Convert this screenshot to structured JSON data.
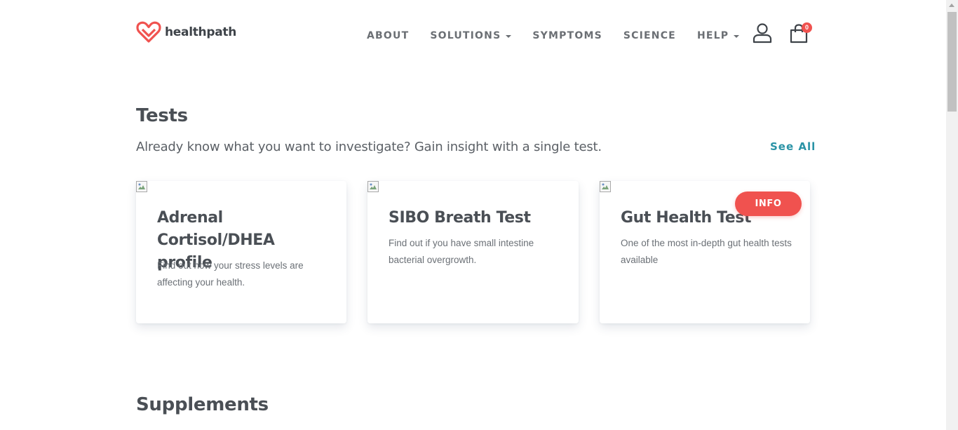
{
  "brand": {
    "name": "healthpath",
    "accent": "#f0524f"
  },
  "nav": {
    "items": [
      {
        "label": "ABOUT",
        "dropdown": false
      },
      {
        "label": "SOLUTIONS",
        "dropdown": true
      },
      {
        "label": "SYMPTOMS",
        "dropdown": false
      },
      {
        "label": "SCIENCE",
        "dropdown": false
      },
      {
        "label": "HELP",
        "dropdown": true
      }
    ],
    "account_icon": "user-icon",
    "cart_icon": "shopping-bag-icon",
    "cart_count": "0"
  },
  "tests": {
    "title": "Tests",
    "subtitle": "Already know what you want to investigate? Gain insight with a single test.",
    "see_all": "See All",
    "cards": [
      {
        "title": "Adrenal Cortisol/DHEA profile",
        "description": "Find out how your stress levels are affecting your health."
      },
      {
        "title": "SIBO Breath Test",
        "description": "Find out if you have small intestine bacterial overgrowth."
      },
      {
        "title": "Gut Health Test",
        "description": "One of the most in-depth gut health tests available"
      }
    ],
    "info_label": "INFO"
  },
  "supplements": {
    "title": "Supplements"
  },
  "colors": {
    "link": "#2a93a6",
    "badge": "#f0524f",
    "heading": "#4a4f55"
  }
}
